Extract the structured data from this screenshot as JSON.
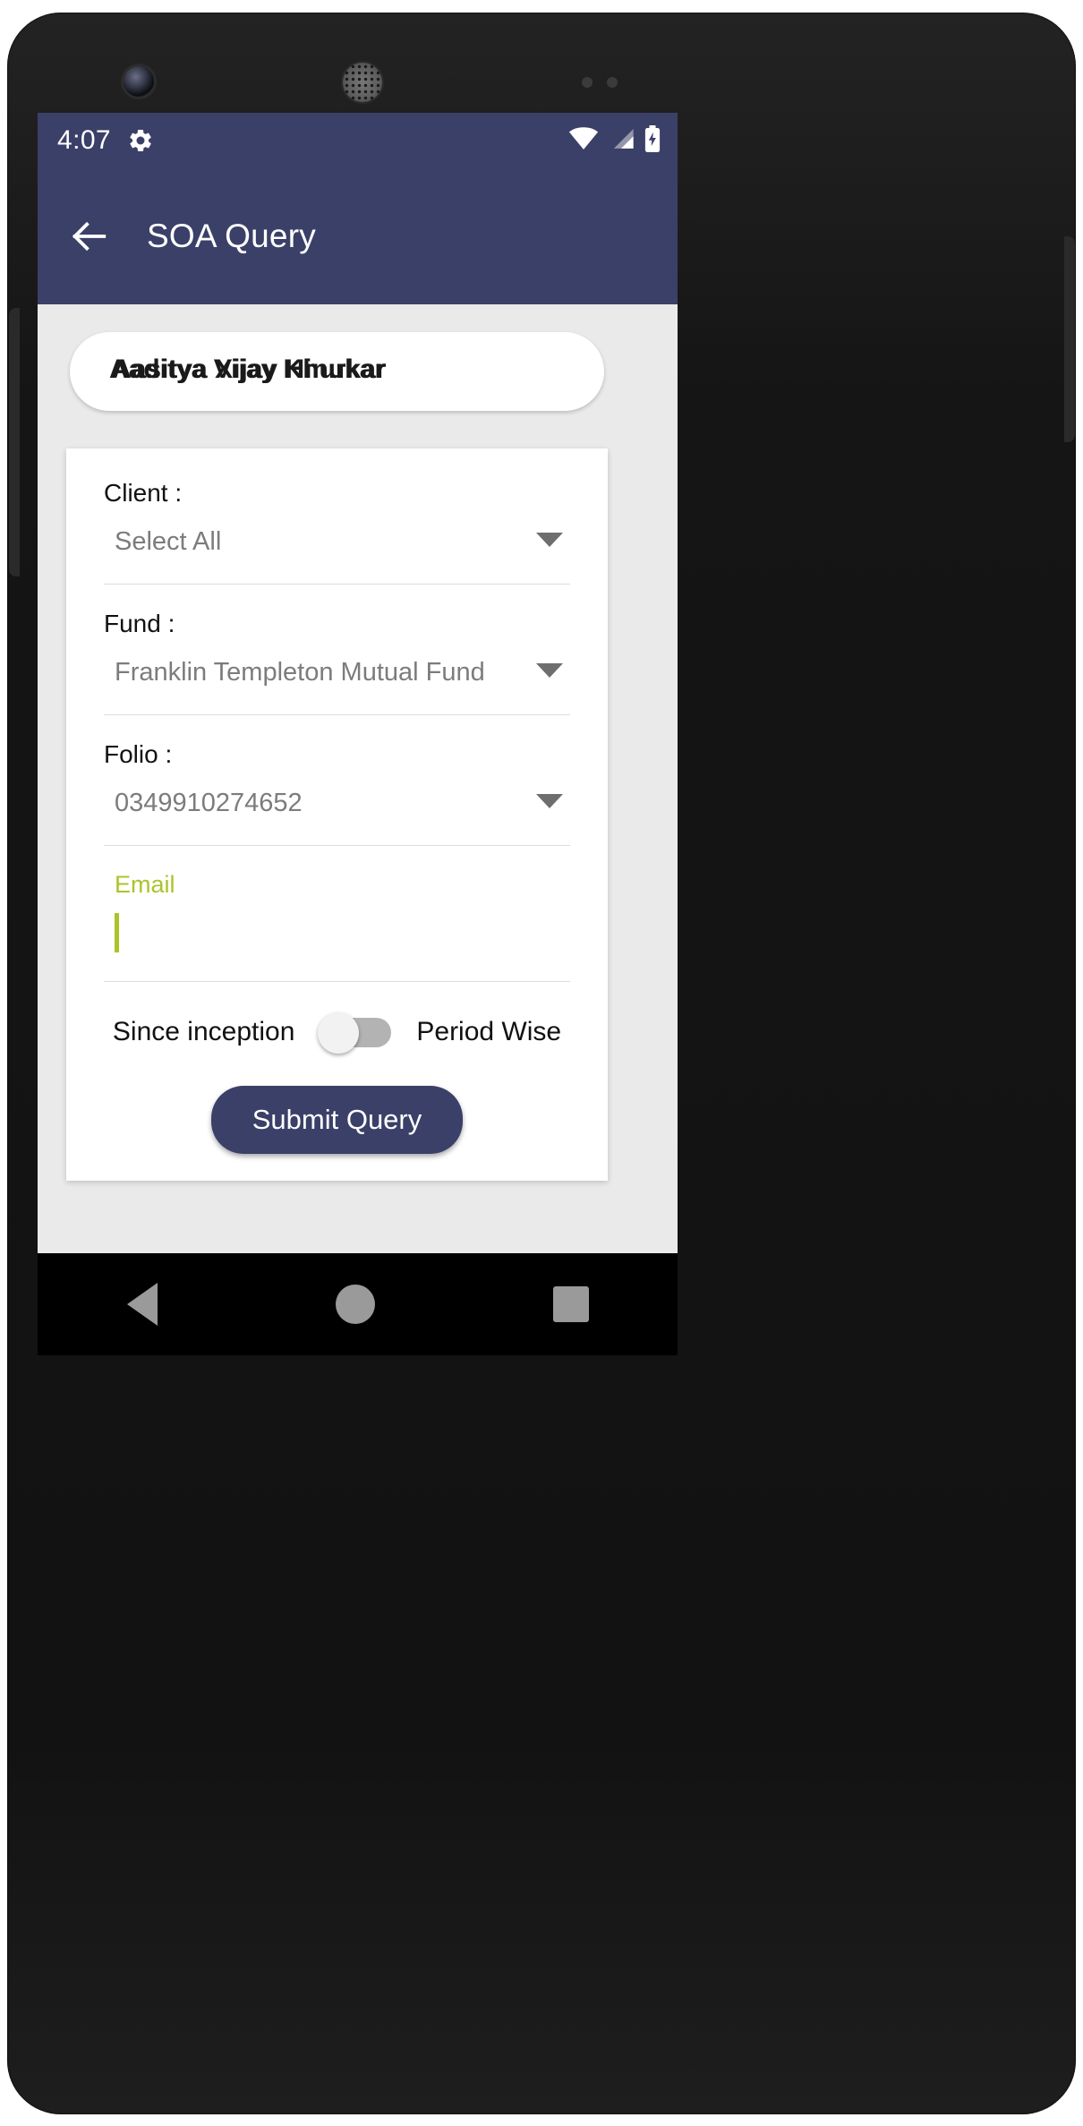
{
  "status_bar": {
    "time": "4:07",
    "gear_icon": "gear-icon",
    "wifi_icon": "wifi-icon",
    "signal_icon": "cellular-signal-icon",
    "battery_icon": "battery-charging-icon"
  },
  "app_bar": {
    "back_icon": "back-arrow-icon",
    "title": "SOA Query",
    "background_color": "#3b4068"
  },
  "name_field": {
    "value_layer_1": "Aaditya Vijay Khurkar",
    "value_layer_2": "Aasitya Xijay Hinukar"
  },
  "form": {
    "client": {
      "label": "Client :",
      "value": "Select All",
      "caret_icon": "chevron-down-icon"
    },
    "fund": {
      "label": "Fund :",
      "value": "Franklin Templeton Mutual Fund",
      "caret_icon": "chevron-down-icon"
    },
    "folio": {
      "label": "Folio :",
      "value": "0349910274652",
      "caret_icon": "chevron-down-icon"
    },
    "email": {
      "label": "Email",
      "value": "",
      "accent_color": "#a9c52a"
    },
    "period_toggle": {
      "left_label": "Since inception",
      "right_label": "Period Wise",
      "state": "off"
    },
    "submit_label": "Submit Query"
  },
  "nav_bar": {
    "back_icon": "nav-back-icon",
    "home_icon": "nav-home-icon",
    "recents_icon": "nav-recents-icon"
  }
}
